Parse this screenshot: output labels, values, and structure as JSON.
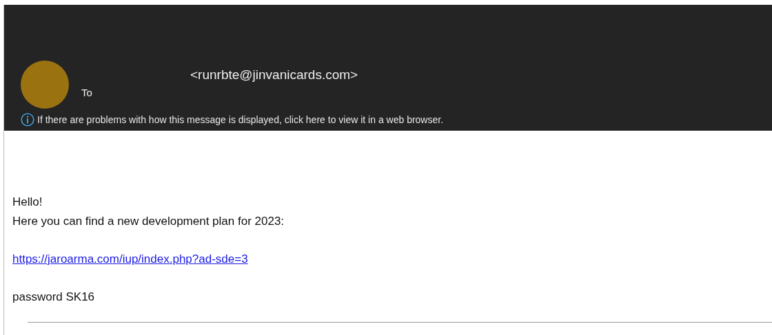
{
  "header": {
    "sender_email": "<runrbte@jinvanicards.com>",
    "to_label": "To",
    "info_message": "If there are problems with how this message is displayed, click here to view it in a web browser."
  },
  "body": {
    "greeting": "Hello!",
    "line": "Here you can find a new development plan for 2023:",
    "link": "https://jaroarma.com/iup/index.php?ad-sde=3",
    "password": "password SK16"
  }
}
